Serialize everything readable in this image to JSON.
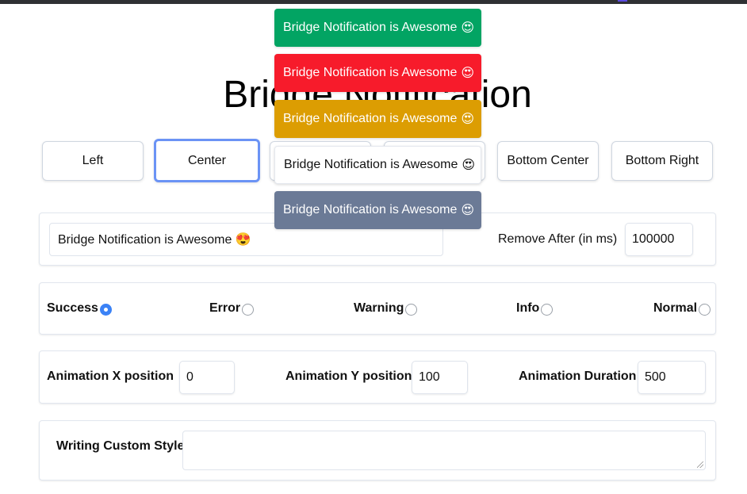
{
  "page": {
    "title": "Bridge Notification"
  },
  "positions": [
    {
      "label": "Left",
      "active": false
    },
    {
      "label": "Center",
      "active": true
    },
    {
      "label": "",
      "active": false
    },
    {
      "label": "",
      "active": false
    },
    {
      "label": "Bottom Center",
      "active": false
    },
    {
      "label": "Bottom Right",
      "active": false
    }
  ],
  "message": {
    "value": "Bridge Notification is Awesome 😍",
    "remove_after_label": "Remove After (in ms)",
    "remove_after_value": "100000"
  },
  "types": {
    "options": [
      {
        "label": "Success",
        "checked": true
      },
      {
        "label": "Error",
        "checked": false
      },
      {
        "label": "Warning",
        "checked": false
      },
      {
        "label": "Info",
        "checked": false
      },
      {
        "label": "Normal",
        "checked": false
      }
    ]
  },
  "animation": {
    "x_label": "Animation X position",
    "x_value": "0",
    "y_label": "Animation Y position",
    "y_value": "100",
    "duration_label": "Animation Duration",
    "duration_value": "500"
  },
  "custom_style": {
    "label": "Writing Custom Style",
    "value": ""
  },
  "toasts": [
    {
      "type": "success",
      "text": "Bridge Notification is Awesome",
      "emoji": "😍",
      "color": "#02a463"
    },
    {
      "type": "error",
      "text": "Bridge Notification is Awesome",
      "emoji": "😍",
      "color": "#f71b2b"
    },
    {
      "type": "warning",
      "text": "Bridge Notification is Awesome",
      "emoji": "😍",
      "color": "#dc9d02"
    },
    {
      "type": "normal",
      "text": "Bridge Notification is Awesome",
      "emoji": "😍",
      "color": "#ffffff"
    },
    {
      "type": "info",
      "text": "Bridge Notification is Awesome",
      "emoji": "😍",
      "color": "#6b7a96"
    }
  ],
  "colors": {
    "focus_ring": "#6b93f5",
    "radio_checked": "#3b82f6"
  }
}
